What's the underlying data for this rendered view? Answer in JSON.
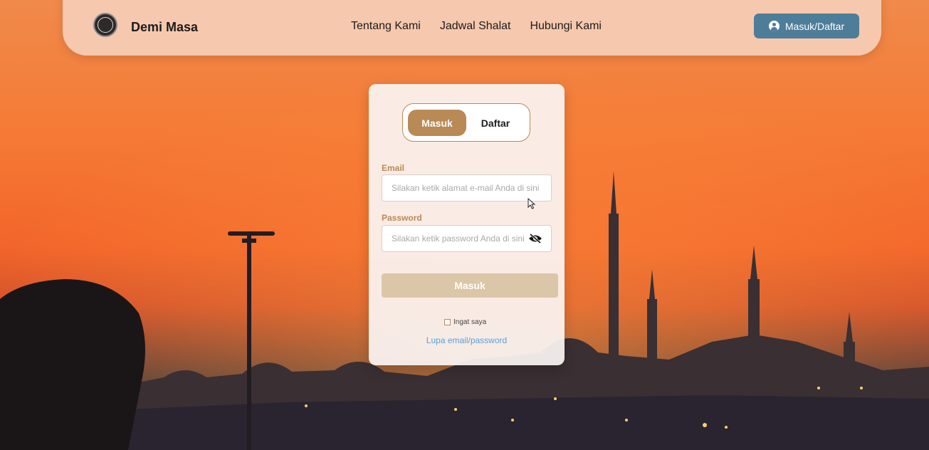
{
  "brand": {
    "name": "Demi Masa",
    "logo_icon": "emblem-logo-icon"
  },
  "nav": {
    "links": [
      "Tentang Kami",
      "Jadwal Shalat",
      "Hubungi Kami"
    ],
    "login_button": {
      "label": "Masuk/Daftar",
      "icon": "user-circle-icon"
    }
  },
  "auth": {
    "tabs": {
      "login": "Masuk",
      "register": "Daftar",
      "active": "Masuk"
    },
    "email": {
      "label": "Email",
      "placeholder": "Silakan ketik alamat e-mail Anda di sini",
      "value": ""
    },
    "password": {
      "label": "Password",
      "placeholder": "Silakan ketik password Anda di sini",
      "value": "",
      "toggle_icon": "eye-slash-icon"
    },
    "submit_label": "Masuk",
    "remember_label": "Ingat saya",
    "remember_checked": false,
    "forgot_label": "Lupa email/password"
  },
  "colors": {
    "accent": "#b98a55",
    "nav_button": "#4d7d99",
    "link": "#5aa0d8",
    "submit_disabled": "#dcc6a8"
  }
}
